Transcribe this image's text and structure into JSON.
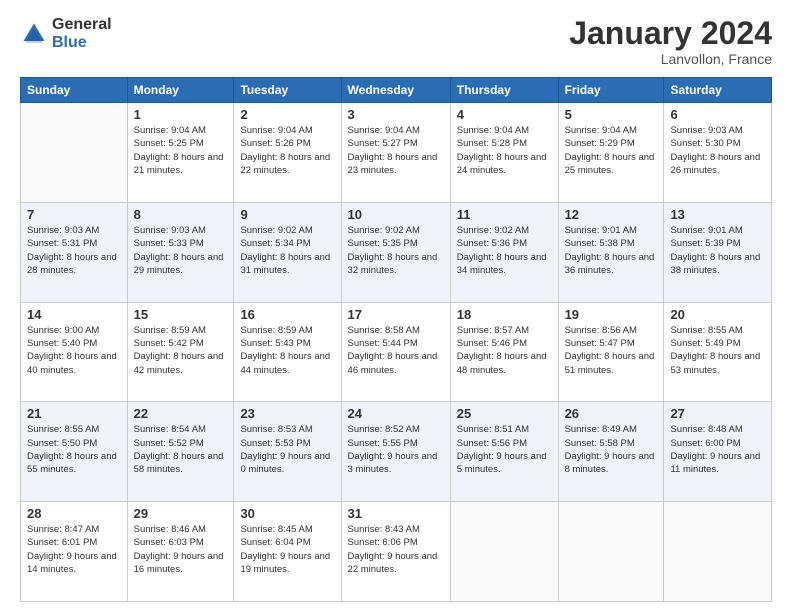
{
  "logo": {
    "general": "General",
    "blue": "Blue"
  },
  "title": "January 2024",
  "location": "Lanvollon, France",
  "headers": [
    "Sunday",
    "Monday",
    "Tuesday",
    "Wednesday",
    "Thursday",
    "Friday",
    "Saturday"
  ],
  "weeks": [
    [
      {
        "day": "",
        "sunrise": "",
        "sunset": "",
        "daylight": ""
      },
      {
        "day": "1",
        "sunrise": "Sunrise: 9:04 AM",
        "sunset": "Sunset: 5:25 PM",
        "daylight": "Daylight: 8 hours and 21 minutes."
      },
      {
        "day": "2",
        "sunrise": "Sunrise: 9:04 AM",
        "sunset": "Sunset: 5:26 PM",
        "daylight": "Daylight: 8 hours and 22 minutes."
      },
      {
        "day": "3",
        "sunrise": "Sunrise: 9:04 AM",
        "sunset": "Sunset: 5:27 PM",
        "daylight": "Daylight: 8 hours and 23 minutes."
      },
      {
        "day": "4",
        "sunrise": "Sunrise: 9:04 AM",
        "sunset": "Sunset: 5:28 PM",
        "daylight": "Daylight: 8 hours and 24 minutes."
      },
      {
        "day": "5",
        "sunrise": "Sunrise: 9:04 AM",
        "sunset": "Sunset: 5:29 PM",
        "daylight": "Daylight: 8 hours and 25 minutes."
      },
      {
        "day": "6",
        "sunrise": "Sunrise: 9:03 AM",
        "sunset": "Sunset: 5:30 PM",
        "daylight": "Daylight: 8 hours and 26 minutes."
      }
    ],
    [
      {
        "day": "7",
        "sunrise": "Sunrise: 9:03 AM",
        "sunset": "Sunset: 5:31 PM",
        "daylight": "Daylight: 8 hours and 28 minutes."
      },
      {
        "day": "8",
        "sunrise": "Sunrise: 9:03 AM",
        "sunset": "Sunset: 5:33 PM",
        "daylight": "Daylight: 8 hours and 29 minutes."
      },
      {
        "day": "9",
        "sunrise": "Sunrise: 9:02 AM",
        "sunset": "Sunset: 5:34 PM",
        "daylight": "Daylight: 8 hours and 31 minutes."
      },
      {
        "day": "10",
        "sunrise": "Sunrise: 9:02 AM",
        "sunset": "Sunset: 5:35 PM",
        "daylight": "Daylight: 8 hours and 32 minutes."
      },
      {
        "day": "11",
        "sunrise": "Sunrise: 9:02 AM",
        "sunset": "Sunset: 5:36 PM",
        "daylight": "Daylight: 8 hours and 34 minutes."
      },
      {
        "day": "12",
        "sunrise": "Sunrise: 9:01 AM",
        "sunset": "Sunset: 5:38 PM",
        "daylight": "Daylight: 8 hours and 36 minutes."
      },
      {
        "day": "13",
        "sunrise": "Sunrise: 9:01 AM",
        "sunset": "Sunset: 5:39 PM",
        "daylight": "Daylight: 8 hours and 38 minutes."
      }
    ],
    [
      {
        "day": "14",
        "sunrise": "Sunrise: 9:00 AM",
        "sunset": "Sunset: 5:40 PM",
        "daylight": "Daylight: 8 hours and 40 minutes."
      },
      {
        "day": "15",
        "sunrise": "Sunrise: 8:59 AM",
        "sunset": "Sunset: 5:42 PM",
        "daylight": "Daylight: 8 hours and 42 minutes."
      },
      {
        "day": "16",
        "sunrise": "Sunrise: 8:59 AM",
        "sunset": "Sunset: 5:43 PM",
        "daylight": "Daylight: 8 hours and 44 minutes."
      },
      {
        "day": "17",
        "sunrise": "Sunrise: 8:58 AM",
        "sunset": "Sunset: 5:44 PM",
        "daylight": "Daylight: 8 hours and 46 minutes."
      },
      {
        "day": "18",
        "sunrise": "Sunrise: 8:57 AM",
        "sunset": "Sunset: 5:46 PM",
        "daylight": "Daylight: 8 hours and 48 minutes."
      },
      {
        "day": "19",
        "sunrise": "Sunrise: 8:56 AM",
        "sunset": "Sunset: 5:47 PM",
        "daylight": "Daylight: 8 hours and 51 minutes."
      },
      {
        "day": "20",
        "sunrise": "Sunrise: 8:55 AM",
        "sunset": "Sunset: 5:49 PM",
        "daylight": "Daylight: 8 hours and 53 minutes."
      }
    ],
    [
      {
        "day": "21",
        "sunrise": "Sunrise: 8:55 AM",
        "sunset": "Sunset: 5:50 PM",
        "daylight": "Daylight: 8 hours and 55 minutes."
      },
      {
        "day": "22",
        "sunrise": "Sunrise: 8:54 AM",
        "sunset": "Sunset: 5:52 PM",
        "daylight": "Daylight: 8 hours and 58 minutes."
      },
      {
        "day": "23",
        "sunrise": "Sunrise: 8:53 AM",
        "sunset": "Sunset: 5:53 PM",
        "daylight": "Daylight: 9 hours and 0 minutes."
      },
      {
        "day": "24",
        "sunrise": "Sunrise: 8:52 AM",
        "sunset": "Sunset: 5:55 PM",
        "daylight": "Daylight: 9 hours and 3 minutes."
      },
      {
        "day": "25",
        "sunrise": "Sunrise: 8:51 AM",
        "sunset": "Sunset: 5:56 PM",
        "daylight": "Daylight: 9 hours and 5 minutes."
      },
      {
        "day": "26",
        "sunrise": "Sunrise: 8:49 AM",
        "sunset": "Sunset: 5:58 PM",
        "daylight": "Daylight: 9 hours and 8 minutes."
      },
      {
        "day": "27",
        "sunrise": "Sunrise: 8:48 AM",
        "sunset": "Sunset: 6:00 PM",
        "daylight": "Daylight: 9 hours and 11 minutes."
      }
    ],
    [
      {
        "day": "28",
        "sunrise": "Sunrise: 8:47 AM",
        "sunset": "Sunset: 6:01 PM",
        "daylight": "Daylight: 9 hours and 14 minutes."
      },
      {
        "day": "29",
        "sunrise": "Sunrise: 8:46 AM",
        "sunset": "Sunset: 6:03 PM",
        "daylight": "Daylight: 9 hours and 16 minutes."
      },
      {
        "day": "30",
        "sunrise": "Sunrise: 8:45 AM",
        "sunset": "Sunset: 6:04 PM",
        "daylight": "Daylight: 9 hours and 19 minutes."
      },
      {
        "day": "31",
        "sunrise": "Sunrise: 8:43 AM",
        "sunset": "Sunset: 6:06 PM",
        "daylight": "Daylight: 9 hours and 22 minutes."
      },
      {
        "day": "",
        "sunrise": "",
        "sunset": "",
        "daylight": ""
      },
      {
        "day": "",
        "sunrise": "",
        "sunset": "",
        "daylight": ""
      },
      {
        "day": "",
        "sunrise": "",
        "sunset": "",
        "daylight": ""
      }
    ]
  ]
}
